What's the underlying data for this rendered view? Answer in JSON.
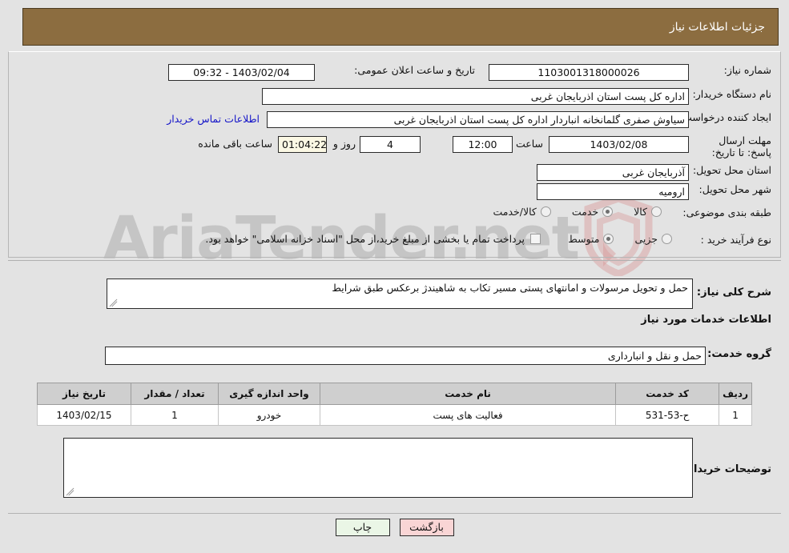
{
  "header": {
    "title": "جزئیات اطلاعات نیاز"
  },
  "top": {
    "need_number_label": "شماره نیاز:",
    "need_number": "1103001318000026",
    "announce_datetime_label": "تاریخ و ساعت اعلان عمومی:",
    "announce_datetime": "09:32 - 1403/02/04",
    "buyer_org_label": "نام دستگاه خریدار:",
    "buyer_org": "اداره کل پست استان اذربایجان غربی",
    "requester_label": "ایجاد کننده درخواست:",
    "requester": "سیاوش صفری گلمانخانه انباردار اداره کل پست استان اذربایجان غربی",
    "contact_link": "اطلاعات تماس خریدار",
    "deadline_label": "مهلت ارسال پاسخ: تا تاریخ:",
    "deadline_date": "1403/02/08",
    "deadline_time_label": "ساعت",
    "deadline_time": "12:00",
    "days_left": "4",
    "days_unit_label": "روز و",
    "countdown": "01:04:22",
    "countdown_unit_label": "ساعت باقی مانده",
    "province_label": "استان محل تحویل:",
    "province": "آذربایجان غربی",
    "city_label": "شهر محل تحویل:",
    "city": "ارومیه",
    "category_label": "طبقه بندی موضوعی:",
    "category_options": [
      {
        "label": "کالا",
        "selected": false
      },
      {
        "label": "خدمت",
        "selected": true
      },
      {
        "label": "کالا/خدمت",
        "selected": false
      }
    ],
    "process_label": "نوع فرآیند خرید :",
    "process_options": [
      {
        "label": "جزیی",
        "selected": false
      },
      {
        "label": "متوسط",
        "selected": true
      }
    ],
    "treasury_checkbox_checked": false,
    "treasury_text": "پرداخت تمام یا بخشی از مبلغ خرید،از محل \"اسناد خزانه اسلامی\" خواهد بود."
  },
  "middle": {
    "need_desc_label": "شرح کلی نیاز:",
    "need_desc": "حمل و تحویل مرسولات و امانتهای پستی مسیر تکاب به شاهیندژ  برعکس طبق شرایط",
    "services_section_title": "اطلاعات خدمات مورد نیاز",
    "service_group_label": "گروه خدمت:",
    "service_group": "حمل و نقل و انبارداری",
    "buyer_notes_label": "توضیحات خریدار:",
    "buyer_notes": ""
  },
  "table": {
    "columns": [
      "ردیف",
      "کد خدمت",
      "نام خدمت",
      "واحد اندازه گیری",
      "تعداد / مقدار",
      "تاریخ نیاز"
    ],
    "rows": [
      {
        "index": "1",
        "code": "ح-53-531",
        "name": "فعالیت های پست",
        "unit": "خودرو",
        "quantity": "1",
        "need_date": "1403/02/15"
      }
    ]
  },
  "buttons": {
    "print": "چاپ",
    "back": "بازگشت"
  },
  "watermark": {
    "text": "AriaTender.net"
  },
  "colors": {
    "header_bg": "#8c6d40",
    "page_bg": "#e3e3e3",
    "link": "#1414c8",
    "table_header_bg": "#cfcfcf",
    "print_btn_bg": "#eaf6e6",
    "back_btn_bg": "#f9d5d5",
    "countdown_bg": "#fbf8e4"
  }
}
